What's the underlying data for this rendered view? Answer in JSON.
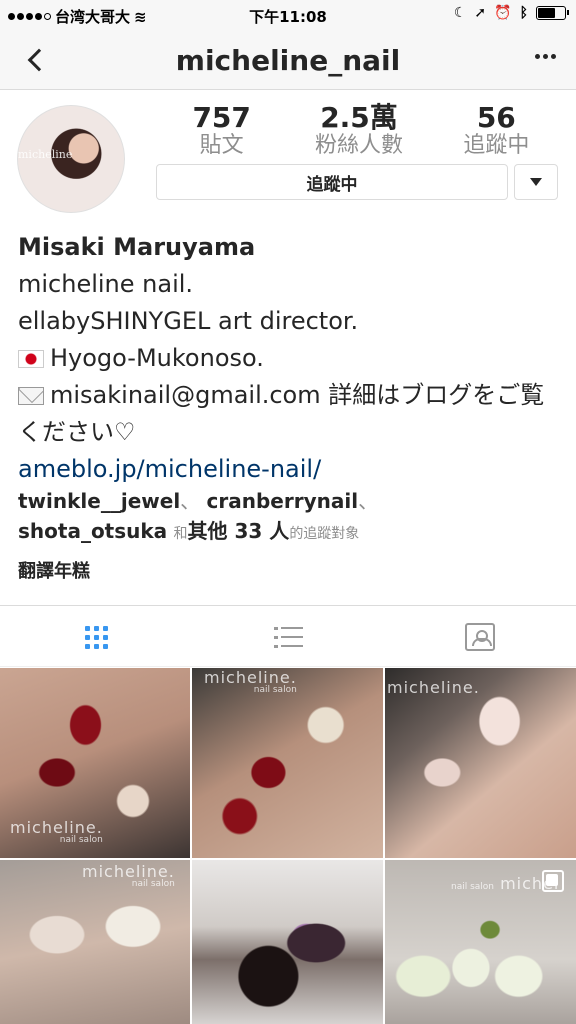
{
  "status_bar": {
    "carrier": "台湾大哥大",
    "time": "下午11:08",
    "battery_level": 0.6
  },
  "nav": {
    "title": "micheline_nail"
  },
  "profile": {
    "avatar_text": "micheline",
    "stats": [
      {
        "value": "757",
        "label": "貼文"
      },
      {
        "value": "2.5萬",
        "label": "粉絲人數"
      },
      {
        "value": "56",
        "label": "追蹤中"
      }
    ],
    "follow_button_label": "追蹤中"
  },
  "bio": {
    "name": "Misaki Maruyama",
    "line1": "micheline nail.",
    "line2": "ellabySHINYGEL art director.",
    "line3": "Hyogo-Mukonoso.",
    "line4": "misakinail@gmail.com 詳細はブログをご覧ください♡",
    "link": "ameblo.jp/micheline-nail/"
  },
  "followed_by": {
    "user1": "twinkle__jewel",
    "user2": "cranberrynail",
    "user3": "shota_otsuka",
    "and": "和",
    "others": "其他 33 人",
    "suffix": "的追蹤對象",
    "separator": "、"
  },
  "translate_label": "翻譯年糕",
  "photo_grid": {
    "labels": [
      {
        "main": "micheline.",
        "sub": "nail salon"
      },
      {
        "main": "micheline.",
        "sub": "nail salon"
      },
      {
        "main": "micheline.",
        "sub": ""
      },
      {
        "main": "micheline.",
        "sub": "nail salon"
      },
      {
        "main": "",
        "sub": ""
      },
      {
        "main": "michel",
        "sub": "nail salon"
      }
    ]
  },
  "icons": {
    "back": "chevron-left-icon",
    "more": "more-horizontal-icon",
    "dropdown": "triangle-down-icon",
    "grid_tab": "grid-icon",
    "list_tab": "list-icon",
    "tagged_tab": "tagged-person-icon",
    "multi_photo": "multiple-photos-icon",
    "accent_color": "#3897f0",
    "link_color": "#003569"
  }
}
